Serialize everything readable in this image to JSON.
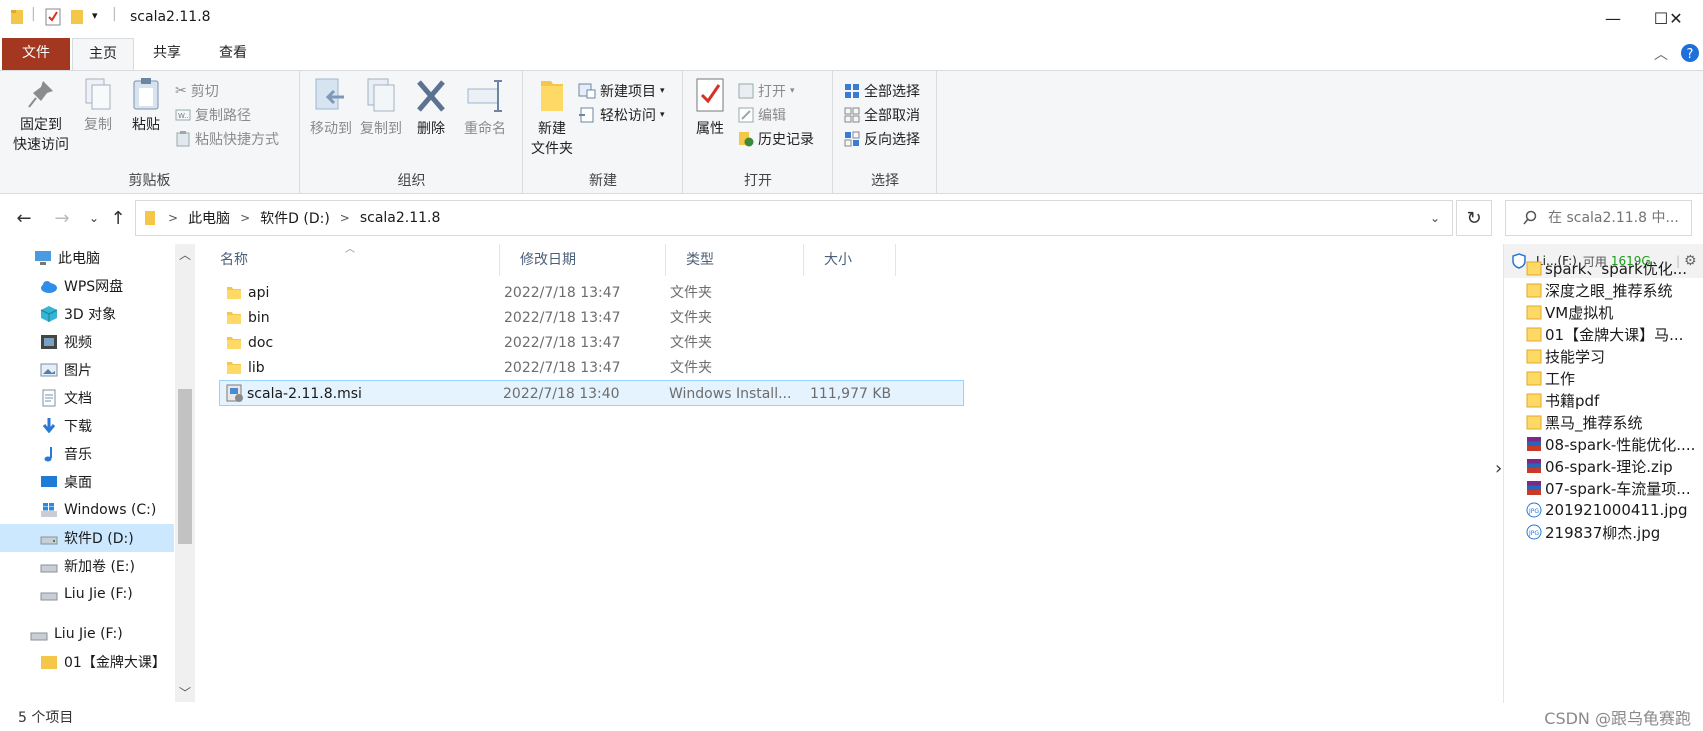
{
  "window": {
    "title": "scala2.11.8",
    "minimize_glyph": "—",
    "maximize_glyph": "☐",
    "close_glyph": "✕"
  },
  "tabs": {
    "file": "文件",
    "home": "主页",
    "share": "共享",
    "view": "查看"
  },
  "ribbon": {
    "clipboard": {
      "label": "剪贴板",
      "pin_line1": "固定到",
      "pin_line2": "快速访问",
      "copy": "复制",
      "paste": "粘贴",
      "cut": "剪切",
      "copy_path": "复制路径",
      "paste_shortcut": "粘贴快捷方式"
    },
    "organize": {
      "label": "组织",
      "move_to": "移动到",
      "copy_to": "复制到",
      "delete": "删除",
      "rename": "重命名"
    },
    "new": {
      "label": "新建",
      "new_folder_line1": "新建",
      "new_folder_line2": "文件夹",
      "new_item": "新建项目",
      "easy_access": "轻松访问"
    },
    "open": {
      "label": "打开",
      "properties": "属性",
      "open": "打开",
      "edit": "编辑",
      "history": "历史记录"
    },
    "select": {
      "label": "选择",
      "select_all": "全部选择",
      "select_none": "全部取消",
      "invert": "反向选择"
    }
  },
  "address": {
    "crumbs": [
      "此电脑",
      "软件D (D:)",
      "scala2.11.8"
    ],
    "search_placeholder": "在 scala2.11.8 中..."
  },
  "nav": {
    "items": [
      {
        "label": "此电脑",
        "icon": "computer-icon"
      },
      {
        "label": "WPS网盘",
        "icon": "cloud-icon"
      },
      {
        "label": "3D 对象",
        "icon": "cube-icon"
      },
      {
        "label": "视频",
        "icon": "video-icon"
      },
      {
        "label": "图片",
        "icon": "picture-icon"
      },
      {
        "label": "文档",
        "icon": "document-icon"
      },
      {
        "label": "下载",
        "icon": "download-icon"
      },
      {
        "label": "音乐",
        "icon": "music-icon"
      },
      {
        "label": "桌面",
        "icon": "desktop-icon"
      },
      {
        "label": "Windows (C:)",
        "icon": "windows-drive-icon"
      },
      {
        "label": "软件D (D:)",
        "icon": "drive-icon"
      },
      {
        "label": "新加卷 (E:)",
        "icon": "drive-icon"
      },
      {
        "label": "Liu Jie  (F:)",
        "icon": "drive-icon"
      },
      {
        "label": "Liu Jie  (F:)",
        "icon": "drive-icon"
      },
      {
        "label": "01【金牌大课】",
        "icon": "folder-icon"
      }
    ]
  },
  "columns": {
    "name": "名称",
    "modified": "修改日期",
    "type": "类型",
    "size": "大小"
  },
  "files": [
    {
      "name": "api",
      "modified": "2022/7/18 13:47",
      "type": "文件夹",
      "size": ""
    },
    {
      "name": "bin",
      "modified": "2022/7/18 13:47",
      "type": "文件夹",
      "size": ""
    },
    {
      "name": "doc",
      "modified": "2022/7/18 13:47",
      "type": "文件夹",
      "size": ""
    },
    {
      "name": "lib",
      "modified": "2022/7/18 13:47",
      "type": "文件夹",
      "size": ""
    },
    {
      "name": "scala-2.11.8.msi",
      "modified": "2022/7/18 13:40",
      "type": "Windows Install...",
      "size": "111,977 KB"
    }
  ],
  "right_pane": {
    "drive": "Li...(F:)",
    "free_label": "可用",
    "free_value": "1619G",
    "items": [
      {
        "label": "spark、spark优化...",
        "icon": "folder-icon"
      },
      {
        "label": "深度之眼_推荐系统",
        "icon": "folder-icon"
      },
      {
        "label": "VM虚拟机",
        "icon": "folder-icon"
      },
      {
        "label": "01【金牌大课】马...",
        "icon": "folder-icon"
      },
      {
        "label": "技能学习",
        "icon": "folder-icon"
      },
      {
        "label": "工作",
        "icon": "folder-icon"
      },
      {
        "label": "书籍pdf",
        "icon": "folder-icon"
      },
      {
        "label": "黑马_推荐系统",
        "icon": "folder-icon"
      },
      {
        "label": "08-spark-性能优化....",
        "icon": "archive-icon"
      },
      {
        "label": "06-spark-理论.zip",
        "icon": "archive-icon"
      },
      {
        "label": "07-spark-车流量项...",
        "icon": "archive-icon"
      },
      {
        "label": "201921000411.jpg",
        "icon": "jpg-icon"
      },
      {
        "label": "219837柳杰.jpg",
        "icon": "jpg-icon"
      }
    ]
  },
  "status": {
    "count": "5 个项目",
    "watermark": "CSDN @跟乌龟赛跑"
  },
  "colors": {
    "file_tab": "#a33720",
    "folder": "#f4c64a",
    "selection": "#cce8ff",
    "free_space": "#1a9b1a"
  }
}
